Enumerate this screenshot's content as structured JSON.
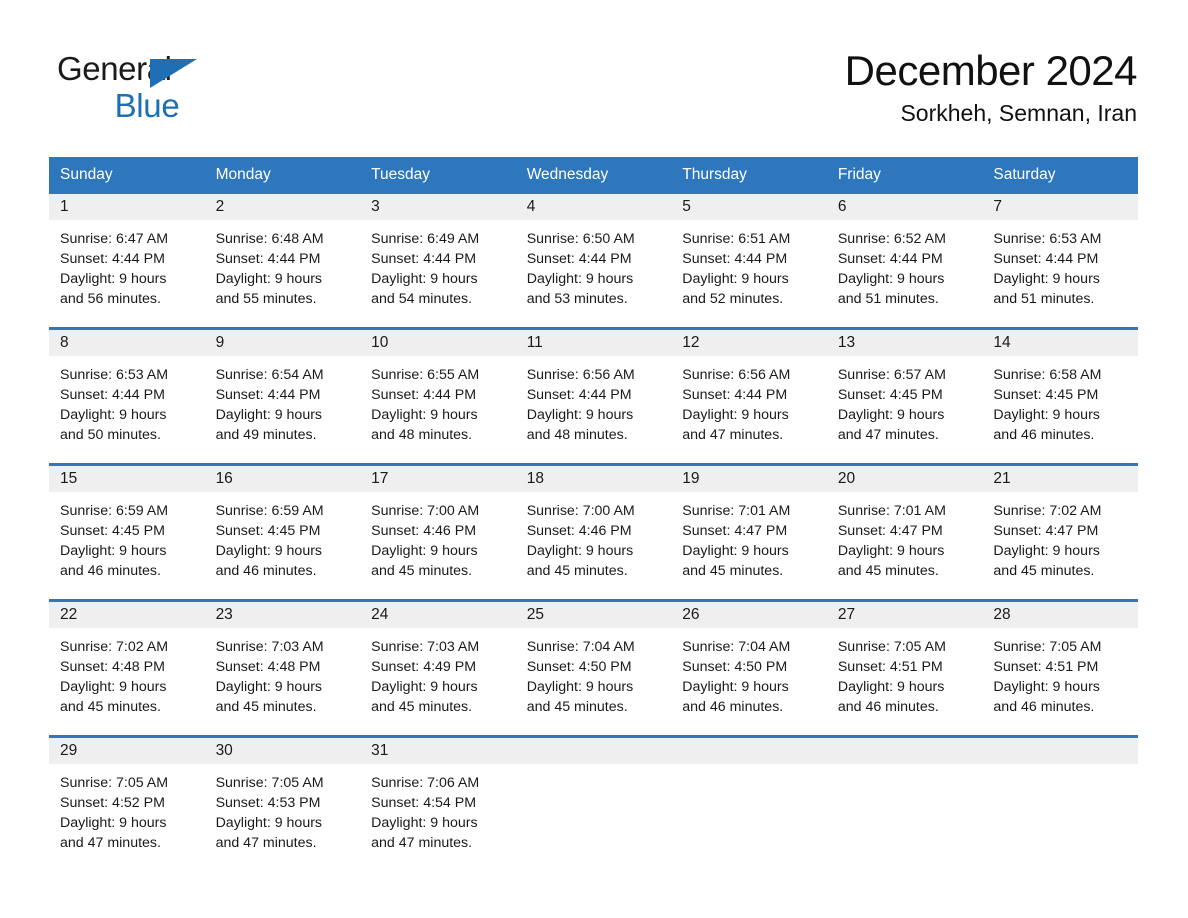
{
  "brand": {
    "name_part1": "General",
    "name_part2": "Blue",
    "accent_color": "#1f6fb5"
  },
  "header": {
    "title": "December 2024",
    "subtitle": "Sorkheh, Semnan, Iran"
  },
  "theme": {
    "header_bar_color": "#2e77bc",
    "day_band_color": "#efefef",
    "text_color": "#1a1a1a",
    "page_background": "#ffffff"
  },
  "weekdays": [
    "Sunday",
    "Monday",
    "Tuesday",
    "Wednesday",
    "Thursday",
    "Friday",
    "Saturday"
  ],
  "weeks": [
    [
      {
        "day": "1",
        "sunrise": "Sunrise: 6:47 AM",
        "sunset": "Sunset: 4:44 PM",
        "daylight_line1": "Daylight: 9 hours",
        "daylight_line2": "and 56 minutes."
      },
      {
        "day": "2",
        "sunrise": "Sunrise: 6:48 AM",
        "sunset": "Sunset: 4:44 PM",
        "daylight_line1": "Daylight: 9 hours",
        "daylight_line2": "and 55 minutes."
      },
      {
        "day": "3",
        "sunrise": "Sunrise: 6:49 AM",
        "sunset": "Sunset: 4:44 PM",
        "daylight_line1": "Daylight: 9 hours",
        "daylight_line2": "and 54 minutes."
      },
      {
        "day": "4",
        "sunrise": "Sunrise: 6:50 AM",
        "sunset": "Sunset: 4:44 PM",
        "daylight_line1": "Daylight: 9 hours",
        "daylight_line2": "and 53 minutes."
      },
      {
        "day": "5",
        "sunrise": "Sunrise: 6:51 AM",
        "sunset": "Sunset: 4:44 PM",
        "daylight_line1": "Daylight: 9 hours",
        "daylight_line2": "and 52 minutes."
      },
      {
        "day": "6",
        "sunrise": "Sunrise: 6:52 AM",
        "sunset": "Sunset: 4:44 PM",
        "daylight_line1": "Daylight: 9 hours",
        "daylight_line2": "and 51 minutes."
      },
      {
        "day": "7",
        "sunrise": "Sunrise: 6:53 AM",
        "sunset": "Sunset: 4:44 PM",
        "daylight_line1": "Daylight: 9 hours",
        "daylight_line2": "and 51 minutes."
      }
    ],
    [
      {
        "day": "8",
        "sunrise": "Sunrise: 6:53 AM",
        "sunset": "Sunset: 4:44 PM",
        "daylight_line1": "Daylight: 9 hours",
        "daylight_line2": "and 50 minutes."
      },
      {
        "day": "9",
        "sunrise": "Sunrise: 6:54 AM",
        "sunset": "Sunset: 4:44 PM",
        "daylight_line1": "Daylight: 9 hours",
        "daylight_line2": "and 49 minutes."
      },
      {
        "day": "10",
        "sunrise": "Sunrise: 6:55 AM",
        "sunset": "Sunset: 4:44 PM",
        "daylight_line1": "Daylight: 9 hours",
        "daylight_line2": "and 48 minutes."
      },
      {
        "day": "11",
        "sunrise": "Sunrise: 6:56 AM",
        "sunset": "Sunset: 4:44 PM",
        "daylight_line1": "Daylight: 9 hours",
        "daylight_line2": "and 48 minutes."
      },
      {
        "day": "12",
        "sunrise": "Sunrise: 6:56 AM",
        "sunset": "Sunset: 4:44 PM",
        "daylight_line1": "Daylight: 9 hours",
        "daylight_line2": "and 47 minutes."
      },
      {
        "day": "13",
        "sunrise": "Sunrise: 6:57 AM",
        "sunset": "Sunset: 4:45 PM",
        "daylight_line1": "Daylight: 9 hours",
        "daylight_line2": "and 47 minutes."
      },
      {
        "day": "14",
        "sunrise": "Sunrise: 6:58 AM",
        "sunset": "Sunset: 4:45 PM",
        "daylight_line1": "Daylight: 9 hours",
        "daylight_line2": "and 46 minutes."
      }
    ],
    [
      {
        "day": "15",
        "sunrise": "Sunrise: 6:59 AM",
        "sunset": "Sunset: 4:45 PM",
        "daylight_line1": "Daylight: 9 hours",
        "daylight_line2": "and 46 minutes."
      },
      {
        "day": "16",
        "sunrise": "Sunrise: 6:59 AM",
        "sunset": "Sunset: 4:45 PM",
        "daylight_line1": "Daylight: 9 hours",
        "daylight_line2": "and 46 minutes."
      },
      {
        "day": "17",
        "sunrise": "Sunrise: 7:00 AM",
        "sunset": "Sunset: 4:46 PM",
        "daylight_line1": "Daylight: 9 hours",
        "daylight_line2": "and 45 minutes."
      },
      {
        "day": "18",
        "sunrise": "Sunrise: 7:00 AM",
        "sunset": "Sunset: 4:46 PM",
        "daylight_line1": "Daylight: 9 hours",
        "daylight_line2": "and 45 minutes."
      },
      {
        "day": "19",
        "sunrise": "Sunrise: 7:01 AM",
        "sunset": "Sunset: 4:47 PM",
        "daylight_line1": "Daylight: 9 hours",
        "daylight_line2": "and 45 minutes."
      },
      {
        "day": "20",
        "sunrise": "Sunrise: 7:01 AM",
        "sunset": "Sunset: 4:47 PM",
        "daylight_line1": "Daylight: 9 hours",
        "daylight_line2": "and 45 minutes."
      },
      {
        "day": "21",
        "sunrise": "Sunrise: 7:02 AM",
        "sunset": "Sunset: 4:47 PM",
        "daylight_line1": "Daylight: 9 hours",
        "daylight_line2": "and 45 minutes."
      }
    ],
    [
      {
        "day": "22",
        "sunrise": "Sunrise: 7:02 AM",
        "sunset": "Sunset: 4:48 PM",
        "daylight_line1": "Daylight: 9 hours",
        "daylight_line2": "and 45 minutes."
      },
      {
        "day": "23",
        "sunrise": "Sunrise: 7:03 AM",
        "sunset": "Sunset: 4:48 PM",
        "daylight_line1": "Daylight: 9 hours",
        "daylight_line2": "and 45 minutes."
      },
      {
        "day": "24",
        "sunrise": "Sunrise: 7:03 AM",
        "sunset": "Sunset: 4:49 PM",
        "daylight_line1": "Daylight: 9 hours",
        "daylight_line2": "and 45 minutes."
      },
      {
        "day": "25",
        "sunrise": "Sunrise: 7:04 AM",
        "sunset": "Sunset: 4:50 PM",
        "daylight_line1": "Daylight: 9 hours",
        "daylight_line2": "and 45 minutes."
      },
      {
        "day": "26",
        "sunrise": "Sunrise: 7:04 AM",
        "sunset": "Sunset: 4:50 PM",
        "daylight_line1": "Daylight: 9 hours",
        "daylight_line2": "and 46 minutes."
      },
      {
        "day": "27",
        "sunrise": "Sunrise: 7:05 AM",
        "sunset": "Sunset: 4:51 PM",
        "daylight_line1": "Daylight: 9 hours",
        "daylight_line2": "and 46 minutes."
      },
      {
        "day": "28",
        "sunrise": "Sunrise: 7:05 AM",
        "sunset": "Sunset: 4:51 PM",
        "daylight_line1": "Daylight: 9 hours",
        "daylight_line2": "and 46 minutes."
      }
    ],
    [
      {
        "day": "29",
        "sunrise": "Sunrise: 7:05 AM",
        "sunset": "Sunset: 4:52 PM",
        "daylight_line1": "Daylight: 9 hours",
        "daylight_line2": "and 47 minutes."
      },
      {
        "day": "30",
        "sunrise": "Sunrise: 7:05 AM",
        "sunset": "Sunset: 4:53 PM",
        "daylight_line1": "Daylight: 9 hours",
        "daylight_line2": "and 47 minutes."
      },
      {
        "day": "31",
        "sunrise": "Sunrise: 7:06 AM",
        "sunset": "Sunset: 4:54 PM",
        "daylight_line1": "Daylight: 9 hours",
        "daylight_line2": "and 47 minutes."
      },
      {
        "day": "",
        "sunrise": "",
        "sunset": "",
        "daylight_line1": "",
        "daylight_line2": ""
      },
      {
        "day": "",
        "sunrise": "",
        "sunset": "",
        "daylight_line1": "",
        "daylight_line2": ""
      },
      {
        "day": "",
        "sunrise": "",
        "sunset": "",
        "daylight_line1": "",
        "daylight_line2": ""
      },
      {
        "day": "",
        "sunrise": "",
        "sunset": "",
        "daylight_line1": "",
        "daylight_line2": ""
      }
    ]
  ]
}
